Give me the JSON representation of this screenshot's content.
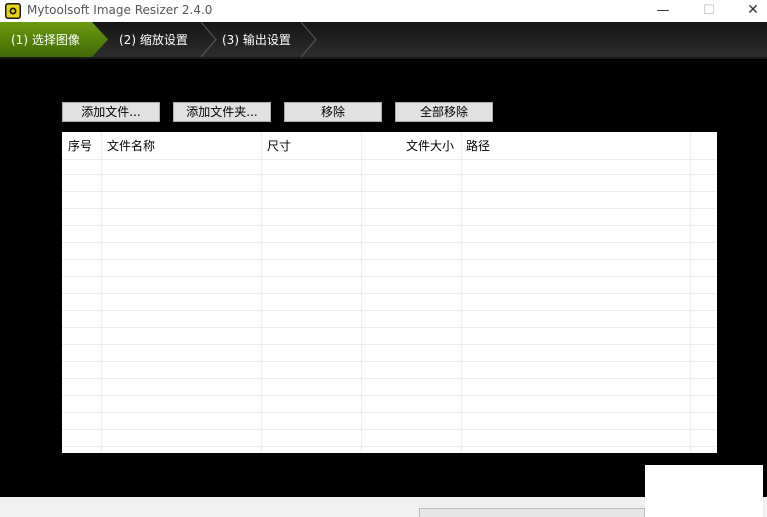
{
  "window": {
    "title": "Mytoolsoft Image Resizer 2.4.0",
    "icon": "app-logo-icon",
    "controls": {
      "minimize": "—",
      "maximize": "☐",
      "close": "✕"
    }
  },
  "steps": [
    {
      "label": "(1) 选择图像",
      "active": true
    },
    {
      "label": "(2) 缩放设置",
      "active": false
    },
    {
      "label": "(3) 输出设置",
      "active": false
    }
  ],
  "toolbar": {
    "add_file": "添加文件...",
    "add_folder": "添加文件夹...",
    "remove": "移除",
    "remove_all": "全部移除"
  },
  "file_table": {
    "columns": [
      "序号",
      "文件名称",
      "尺寸",
      "文件大小",
      "路径"
    ],
    "rows": []
  },
  "colors": {
    "accent": "#5a8a0a",
    "background": "#000000"
  }
}
